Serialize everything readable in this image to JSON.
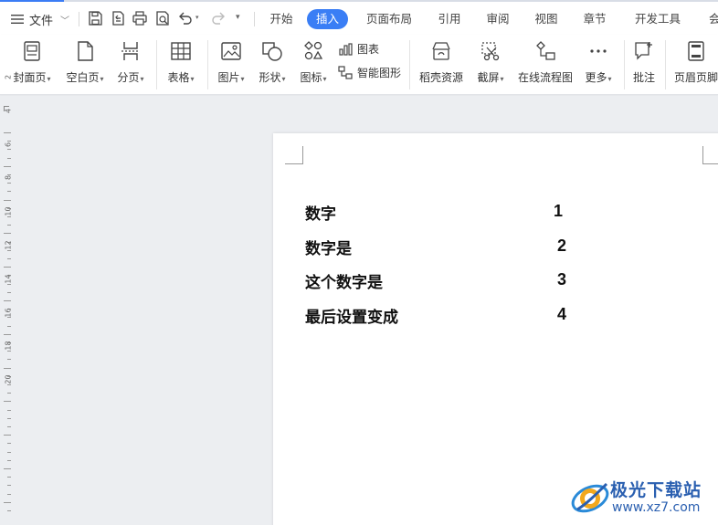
{
  "menu": {
    "file_label": "文件",
    "tabs": [
      "开始",
      "插入",
      "页面布局",
      "引用",
      "审阅",
      "视图",
      "章节",
      "开发工具",
      "会"
    ],
    "active_tab": "插入"
  },
  "ribbon": {
    "cover": "封面页",
    "blank": "空白页",
    "page_break": "分页",
    "table": "表格",
    "picture": "图片",
    "shape": "形状",
    "icon": "图标",
    "chart": "图表",
    "smart_shape": "智能图形",
    "docer_resources": "稻壳资源",
    "screenshot": "截屏",
    "flowchart": "在线流程图",
    "more": "更多",
    "comment": "批注",
    "header_footer": "页眉页脚"
  },
  "document": {
    "lines": [
      {
        "label": "数字",
        "value": "1"
      },
      {
        "label": "数字是",
        "value": "2"
      },
      {
        "label": "这个数字是",
        "value": "3"
      },
      {
        "label": "最后设置变成",
        "value": "4"
      }
    ]
  },
  "ruler": {
    "numbers": [
      "2",
      "4",
      "6",
      "8",
      "10",
      "12",
      "14",
      "16",
      "18",
      "20"
    ]
  },
  "watermark": {
    "title": "极光下载站",
    "url": "www.xz7.com"
  },
  "colors": {
    "accent": "#3a7ef5",
    "background": "#eceef1",
    "watermark": "#2a5fb0"
  }
}
